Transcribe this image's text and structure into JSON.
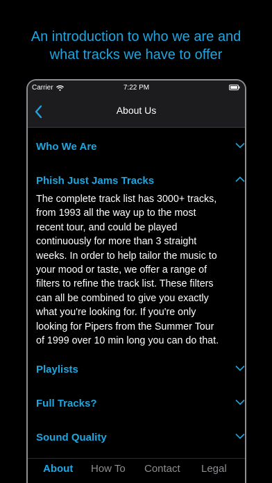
{
  "headline": {
    "line1": "An introduction to who we are and",
    "line2": "what tracks we have to offer"
  },
  "statusbar": {
    "carrier": "Carrier",
    "time": "7:22 PM"
  },
  "navbar": {
    "title": "About Us",
    "back_icon": "chevron-left-icon"
  },
  "sections": [
    {
      "label": "Who We Are",
      "expanded": false
    },
    {
      "label": "Phish Just Jams Tracks",
      "expanded": true
    },
    {
      "label": "Playlists",
      "expanded": false
    },
    {
      "label": "Full Tracks?",
      "expanded": false
    },
    {
      "label": "Sound Quality",
      "expanded": false
    }
  ],
  "expanded_text": [
    "The complete track list has 3000+ tracks,",
    "from 1993 all the way up to the most",
    "recent tour, and could be played",
    "continuously for more than 3 straight",
    "weeks.  In order to help tailor the music to",
    "your mood or taste, we offer a range of",
    "filters to refine the track list.  These filters",
    "can all be combined to give you exactly",
    "what you're looking for.  If you're only",
    "looking for Pipers from the Summer Tour",
    "of 1999 over 10 min long you can do that."
  ],
  "tabs": [
    {
      "label": "About",
      "active": true
    },
    {
      "label": "How To",
      "active": false
    },
    {
      "label": "Contact",
      "active": false
    },
    {
      "label": "Legal",
      "active": false
    }
  ],
  "colors": {
    "accent": "#1fa6e0",
    "background": "#000000",
    "bar": "#1c1c1e",
    "inactive_tab": "#8e8e93"
  }
}
